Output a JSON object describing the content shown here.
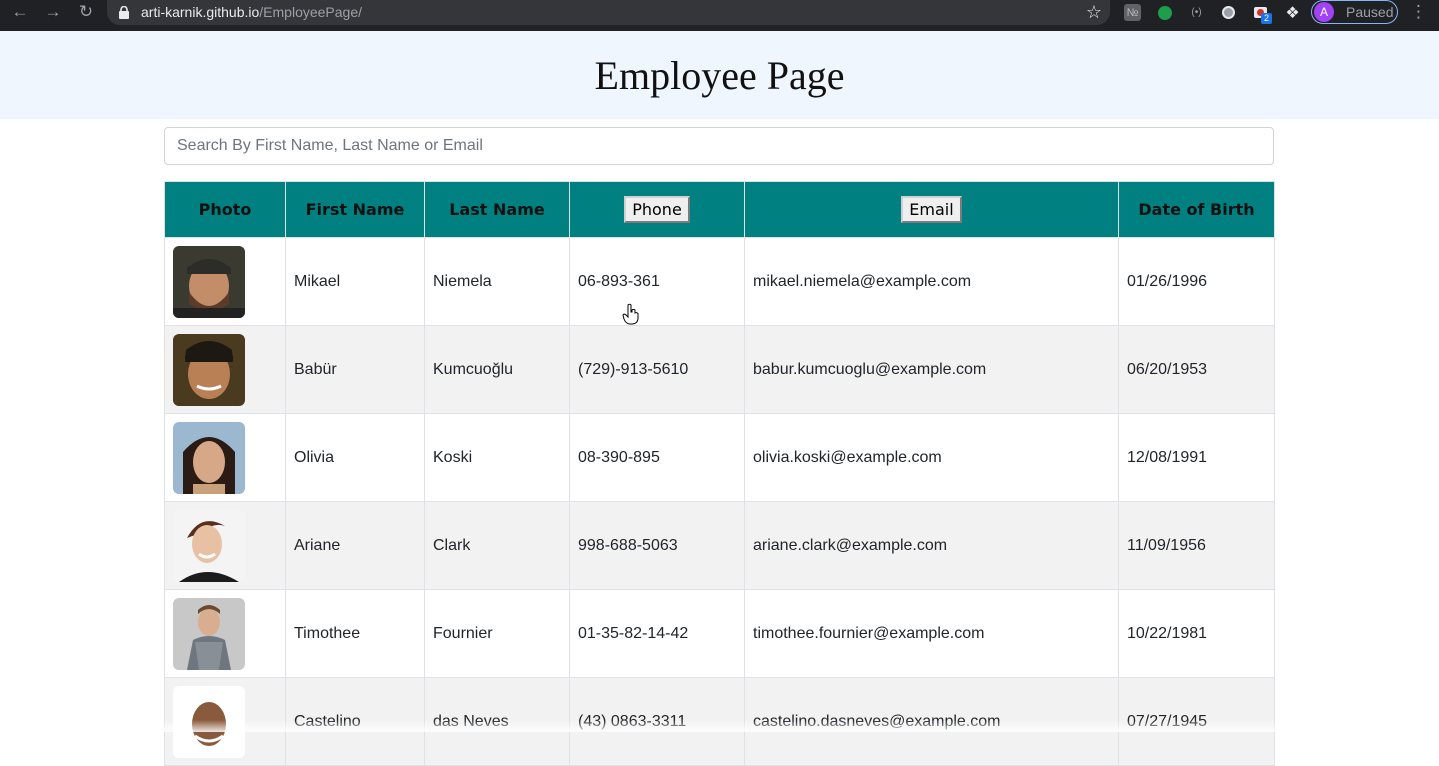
{
  "browser": {
    "url_host": "arti-karnik.github.io",
    "url_path": "/EmployeePage/",
    "profile_initial": "A",
    "profile_status": "Paused",
    "extension_badge": "2"
  },
  "page": {
    "title": "Employee Page",
    "search_placeholder": "Search By First Name, Last Name or Email"
  },
  "table": {
    "headers": {
      "photo": "Photo",
      "first_name": "First Name",
      "last_name": "Last Name",
      "phone": "Phone",
      "email": "Email",
      "dob": "Date of Birth"
    },
    "rows": [
      {
        "first": "Mikael",
        "last": "Niemela",
        "phone": "06-893-361",
        "email": "mikael.niemela@example.com",
        "dob": "01/26/1996"
      },
      {
        "first": "Babür",
        "last": "Kumcuoğlu",
        "phone": "(729)-913-5610",
        "email": "babur.kumcuoglu@example.com",
        "dob": "06/20/1953"
      },
      {
        "first": "Olivia",
        "last": "Koski",
        "phone": "08-390-895",
        "email": "olivia.koski@example.com",
        "dob": "12/08/1991"
      },
      {
        "first": "Ariane",
        "last": "Clark",
        "phone": "998-688-5063",
        "email": "ariane.clark@example.com",
        "dob": "11/09/1956"
      },
      {
        "first": "Timothee",
        "last": "Fournier",
        "phone": "01-35-82-14-42",
        "email": "timothee.fournier@example.com",
        "dob": "10/22/1981"
      },
      {
        "first": "Castelino",
        "last": "das Neves",
        "phone": "(43) 0863-3311",
        "email": "castelino.dasneves@example.com",
        "dob": "07/27/1945"
      }
    ]
  },
  "colors": {
    "header_bg": "#f0f6fe",
    "table_header_bg": "#008080",
    "row_alt_bg": "#f2f2f2"
  }
}
